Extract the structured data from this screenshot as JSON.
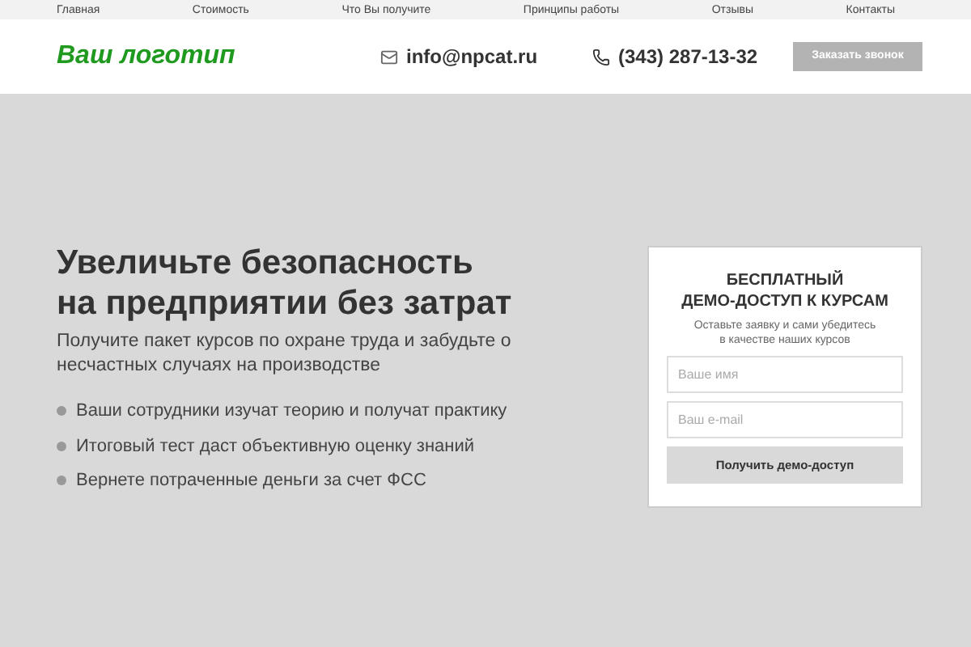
{
  "nav": [
    "Главная",
    "Стоимость",
    "Что Вы получите",
    "Принципы работы",
    "Отзывы",
    "Контакты"
  ],
  "header": {
    "logo": "Ваш логотип",
    "email": "info@npcat.ru",
    "phone": "(343) 287-13-32",
    "call_button": "Заказать звонок"
  },
  "hero": {
    "title_lines": [
      "Увеличьте безопасность",
      "на предприятии без затрат"
    ],
    "subtitle": "Получите пакет курсов по охране труда и забудьте о несчастных случаях на производстве",
    "bullets": [
      "Ваши сотрудники изучат теорию и получат практику",
      "Итоговый тест даст объективную оценку знаний",
      "Вернете потраченные деньги за счет ФСС"
    ]
  },
  "form": {
    "title_lines": [
      "БЕСПЛАТНЫЙ",
      "ДЕМО-ДОСТУП К КУРСАМ"
    ],
    "note_lines": [
      "Оставьте заявку и сами убедитесь",
      "в качестве наших курсов"
    ],
    "fields": [
      {
        "placeholder": "Ваше имя"
      },
      {
        "placeholder": "Ваш e-mail"
      }
    ],
    "submit": "Получить демо-доступ"
  }
}
